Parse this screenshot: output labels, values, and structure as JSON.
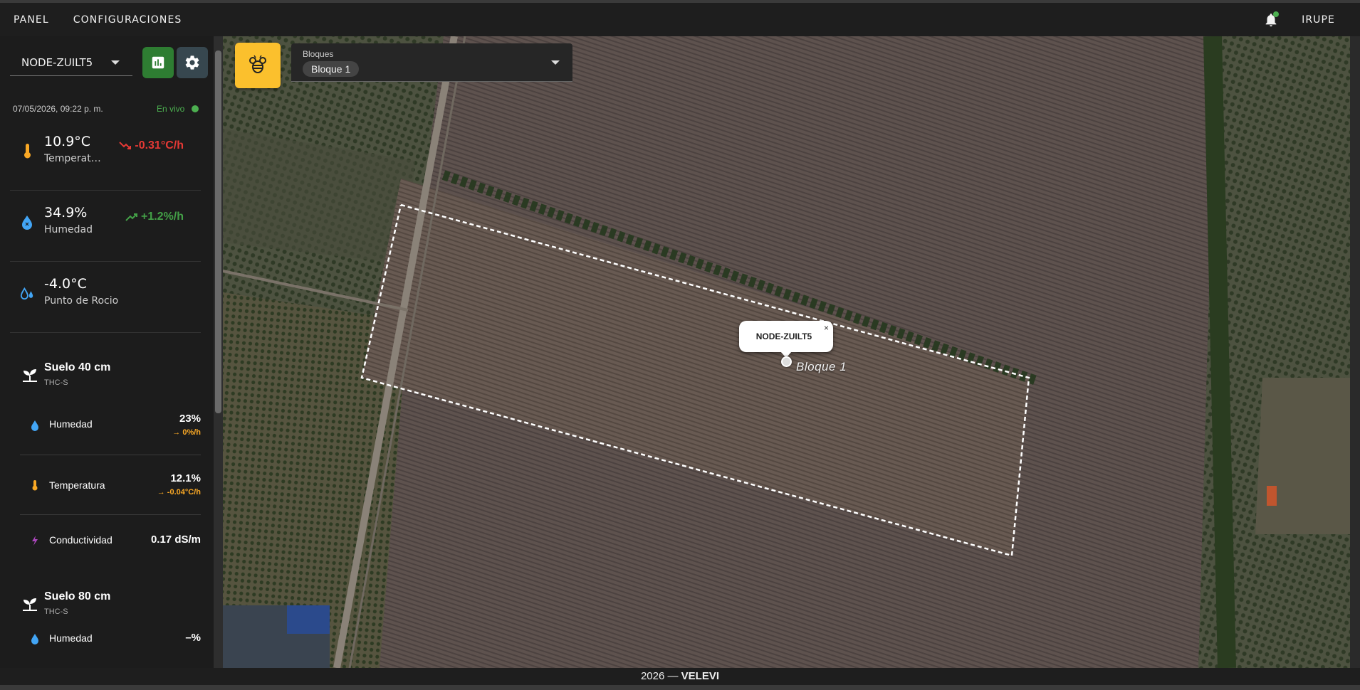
{
  "nav": {
    "panel": "PANEL",
    "config": "CONFIGURACIONES",
    "user": "IRUPE"
  },
  "sidebar": {
    "node": "NODE-ZUILT5",
    "datetime": "07/05/2026, 09:22 p. m.",
    "live": "En vivo",
    "metrics": [
      {
        "value": "10.9°C",
        "label": "Temperatura",
        "trend": "-0.31°C/h",
        "dir": "down",
        "icon": "thermometer-icon"
      },
      {
        "value": "34.9%",
        "label": "Humedad",
        "trend": "+1.2%/h",
        "dir": "up",
        "icon": "water-drop-icon"
      },
      {
        "value": "-4.0°C",
        "label": "Punto de Rocio",
        "trend": "",
        "icon": "dew-point-icon"
      }
    ],
    "soil40": {
      "title": "Suelo 40 cm",
      "sub": "THC-S",
      "rows": [
        {
          "label": "Humedad",
          "value": "23%",
          "trend": "→ 0%/h"
        },
        {
          "label": "Temperatura",
          "value": "12.1%",
          "trend": "→ -0.04°C/h"
        },
        {
          "label": "Conductividad",
          "value": "0.17 dS/m"
        }
      ]
    },
    "soil80": {
      "title": "Suelo 80 cm",
      "sub": "THC-S",
      "rows": [
        {
          "label": "Humedad",
          "value": "–%"
        }
      ]
    }
  },
  "map": {
    "blocks_label": "Bloques",
    "blocks_selected": "Bloque 1",
    "popup_title": "NODE-ZUILT5",
    "popup_close": "×",
    "block_name": "Bloque 1"
  },
  "footer": {
    "year": "2026 —",
    "brand": "VELEVI"
  },
  "colors": {
    "trend_down": "#e53935",
    "trend_up": "#43a047",
    "trend_flat": "#f9a825",
    "chart_button": "#2e7d32",
    "bee_button": "#fbc02d"
  }
}
